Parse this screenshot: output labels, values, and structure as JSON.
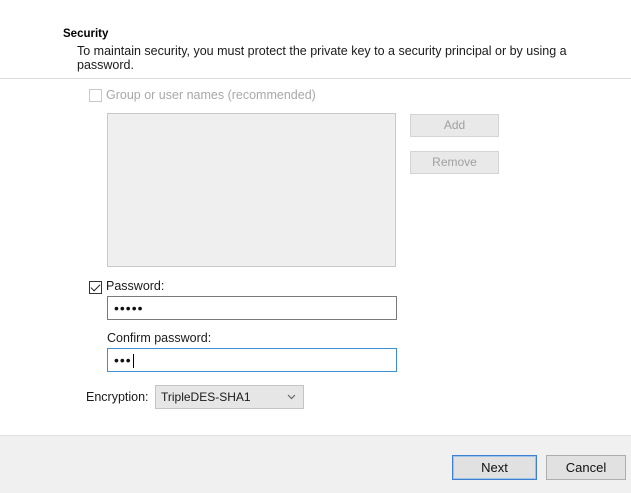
{
  "security": {
    "title": "Security",
    "description": "To maintain security, you must protect the private key to a security principal or by using a password."
  },
  "group": {
    "checkbox_label": "Group or user names (recommended)",
    "checked": false,
    "enabled": false,
    "add_label": "Add",
    "remove_label": "Remove"
  },
  "password": {
    "checkbox_label": "Password:",
    "checked": true,
    "value": "•••••",
    "confirm_label": "Confirm password:",
    "confirm_value": "•••"
  },
  "encryption": {
    "label": "Encryption:",
    "selected": "TripleDES-SHA1"
  },
  "footer": {
    "next_label": "Next",
    "cancel_label": "Cancel"
  },
  "colors": {
    "focus_border": "#3b8fd6",
    "default_button_border": "#3f7fd0"
  },
  "icons": {
    "dropdown": "chevron-down-icon",
    "checkbox": "checkmark-icon"
  }
}
